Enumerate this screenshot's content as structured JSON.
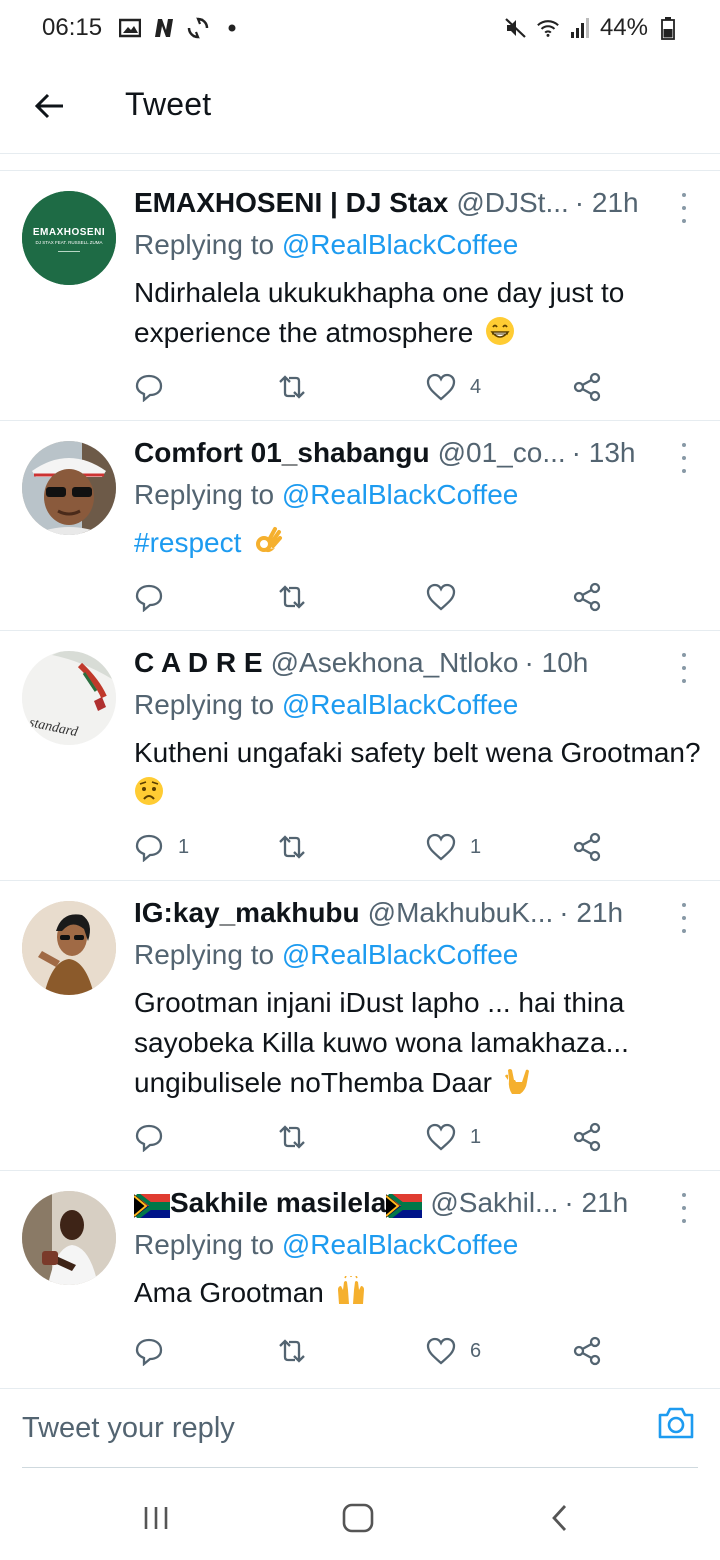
{
  "status_bar": {
    "time": "06:15",
    "battery": "44%",
    "left_icons": [
      "gallery-icon",
      "n-icon",
      "sync-icon",
      "dot-icon"
    ],
    "right_icons": [
      "mute-icon",
      "wifi-icon",
      "signal-icon",
      "battery-icon"
    ]
  },
  "header": {
    "title": "Tweet",
    "back_icon": "arrow-left-icon"
  },
  "tweets": [
    {
      "name": "EMAXHOSENI | DJ Stax",
      "handle": "@DJSt...",
      "time": "· 21h",
      "replying_prefix": "Replying to ",
      "replying_to": "@RealBlackCoffee",
      "text": "Ndirhalela ukukukhapha one day just to experience the atmosphere",
      "emoji": "grinning-face",
      "avatar_text": "EMAXHOSENI",
      "avatar_subtext": "DJ STAX FEAT. RUSSELL ZUMA",
      "replies": "",
      "retweets": "",
      "likes": "4"
    },
    {
      "name": "Comfort 01_shabangu",
      "handle": "@01_co...",
      "time": "· 13h",
      "replying_prefix": "Replying to ",
      "replying_to": "@RealBlackCoffee",
      "text": "#respect",
      "emoji": "ok-hand",
      "replies": "",
      "retweets": "",
      "likes": ""
    },
    {
      "name": "C A D R E",
      "handle": "@Asekhona_Ntloko",
      "time": "· 10h",
      "replying_prefix": "Replying to ",
      "replying_to": "@RealBlackCoffee",
      "text": "Kutheni ungafaki safety belt wena Grootman?",
      "emoji": "worried-face",
      "avatar_text": "standard",
      "replies": "1",
      "retweets": "",
      "likes": "1"
    },
    {
      "name": "IG:kay_makhubu",
      "handle": "@MakhubuK...",
      "time": "· 21h",
      "replying_prefix": "Replying to ",
      "replying_to": "@RealBlackCoffee",
      "text": "Grootman injani iDust lapho ... hai thina sayobeka Killa kuwo wona lamakhaza... ungibulisele noThemba Daar",
      "emoji": "love-you-gesture",
      "replies": "",
      "retweets": "",
      "likes": "1"
    },
    {
      "name": "Sakhile masilela",
      "handle": "@Sakhil...",
      "time": "· 21h",
      "replying_prefix": "Replying to ",
      "replying_to": "@RealBlackCoffee",
      "text": "Ama Grootman",
      "emoji": "raising-hands",
      "replies": "",
      "retweets": "",
      "likes": "6"
    }
  ],
  "reply_bar": {
    "placeholder": "Tweet your reply",
    "camera_icon": "camera-icon"
  },
  "nav_bar": {
    "icons": [
      "recent-apps-icon",
      "home-icon",
      "back-icon"
    ]
  },
  "colors": {
    "link": "#1d9bf0",
    "secondary_text": "#536471",
    "divider": "#e6ecf0",
    "avatar_green": "#1e6b45"
  }
}
